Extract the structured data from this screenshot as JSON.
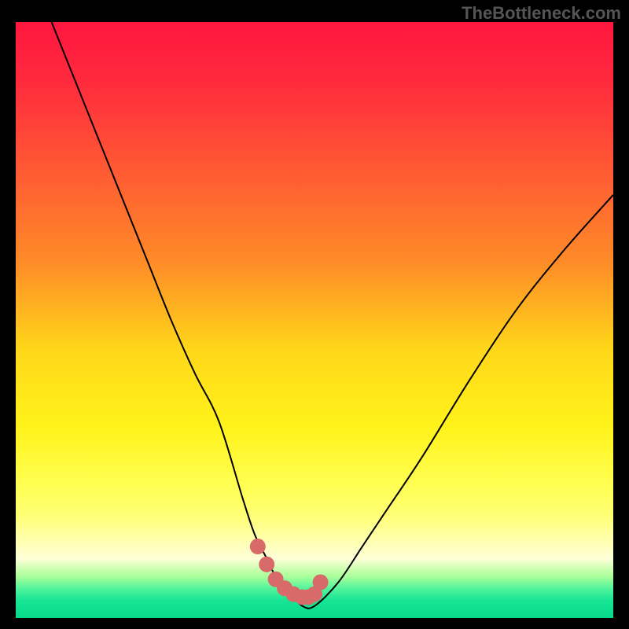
{
  "watermark": "TheBottleneck.com",
  "chart_data": {
    "type": "line",
    "title": "",
    "xlabel": "",
    "ylabel": "",
    "xlim": [
      0,
      100
    ],
    "ylim": [
      0,
      100
    ],
    "grid": false,
    "background_gradient": {
      "direction": "vertical",
      "stops": [
        {
          "pos": 0.0,
          "color": "#ff163f"
        },
        {
          "pos": 0.1,
          "color": "#ff2a3d"
        },
        {
          "pos": 0.25,
          "color": "#ff5a33"
        },
        {
          "pos": 0.4,
          "color": "#ff8a28"
        },
        {
          "pos": 0.55,
          "color": "#ffd71a"
        },
        {
          "pos": 0.68,
          "color": "#fff31a"
        },
        {
          "pos": 0.78,
          "color": "#ffff55"
        },
        {
          "pos": 0.83,
          "color": "#ffff77"
        },
        {
          "pos": 0.87,
          "color": "#ffffb0"
        },
        {
          "pos": 0.9,
          "color": "#ffffd8"
        },
        {
          "pos": 0.93,
          "color": "#aaff99"
        },
        {
          "pos": 0.95,
          "color": "#55f59d"
        },
        {
          "pos": 0.97,
          "color": "#18e594"
        },
        {
          "pos": 1.0,
          "color": "#06d98a"
        }
      ]
    },
    "series": [
      {
        "name": "bottleneck_curve",
        "kind": "line",
        "color": "#000000",
        "weight": 2,
        "x": [
          6,
          10,
          14,
          18,
          22,
          26,
          30,
          34,
          38,
          40,
          42,
          44,
          46,
          48,
          50,
          54,
          58,
          62,
          68,
          76,
          84,
          92,
          100
        ],
        "y": [
          100,
          90,
          80,
          70,
          60,
          50,
          41,
          33,
          20,
          14,
          10,
          6,
          4,
          2,
          2,
          6,
          12,
          18,
          27,
          40,
          52,
          62,
          71
        ]
      },
      {
        "name": "highlight_markers",
        "kind": "scatter",
        "color": "#d96a6a",
        "marker_size": 10,
        "x": [
          40.5,
          42,
          43.5,
          45,
          46.5,
          48,
          49,
          50,
          51
        ],
        "y": [
          12,
          9,
          6.5,
          5,
          4,
          3.5,
          3.5,
          4,
          6
        ]
      }
    ]
  }
}
